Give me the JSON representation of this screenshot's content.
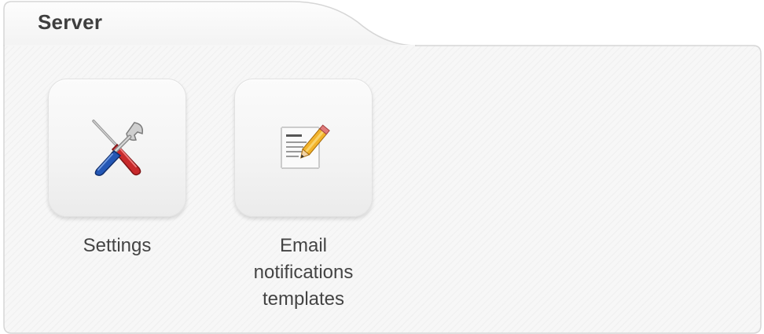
{
  "panel": {
    "title": "Server"
  },
  "tiles": [
    {
      "label": "Settings",
      "icon": "tools-icon"
    },
    {
      "label_lines": [
        "Email",
        "notifications",
        "templates"
      ],
      "icon": "notepad-pencil-icon"
    }
  ],
  "colors": {
    "panel_border": "#d6d6d6",
    "panel_bg": "#f7f7f7",
    "title_text": "#3f3f3f",
    "label_text": "#444444"
  }
}
